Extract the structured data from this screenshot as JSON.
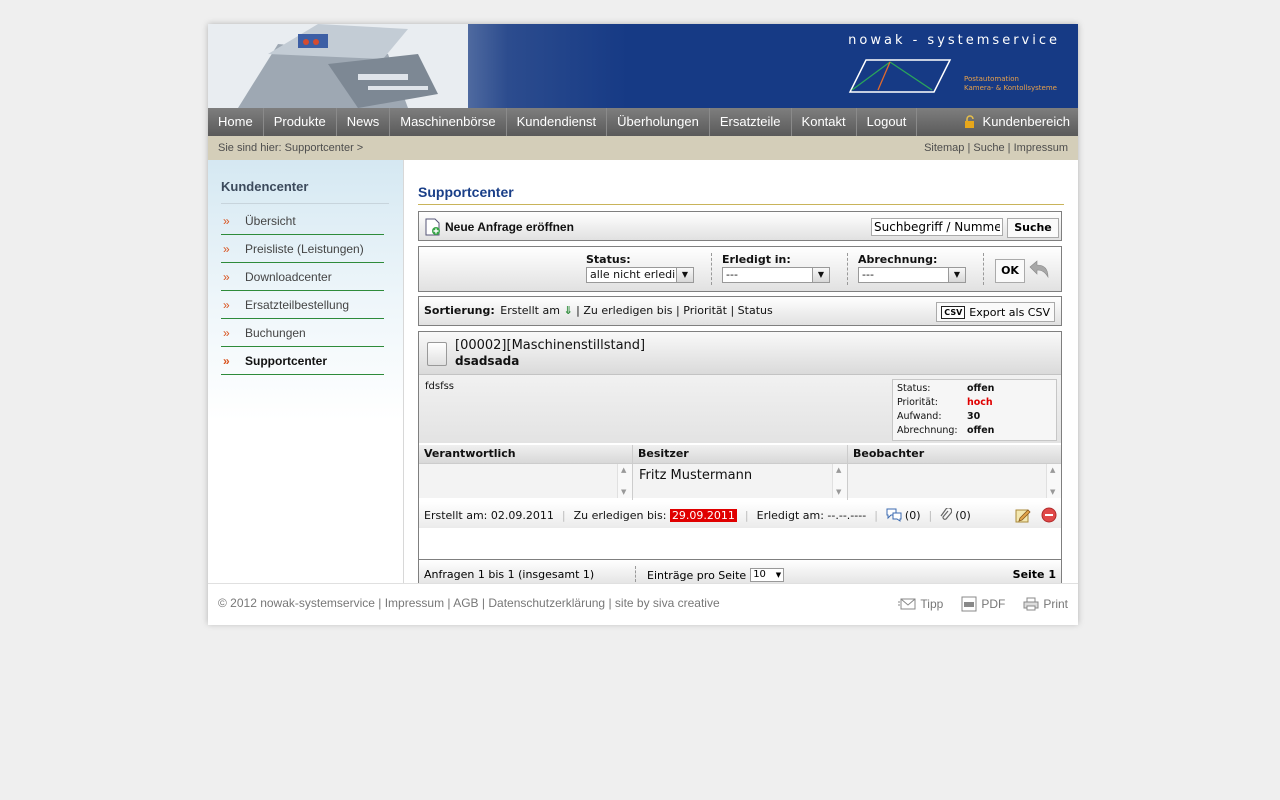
{
  "brand": {
    "name": "nowak - systemservice",
    "tagline_line1": "Postautomation",
    "tagline_line2": "Kamera- & Kontollsysteme"
  },
  "nav": {
    "items": [
      "Home",
      "Produkte",
      "News",
      "Maschinenbörse",
      "Kundendienst",
      "Überholungen",
      "Ersatzteile",
      "Kontakt",
      "Logout"
    ],
    "customer_area": "Kundenbereich"
  },
  "breadcrumb": {
    "text": "Sie sind hier: Supportcenter >",
    "sitemap": "Sitemap",
    "search": "Suche",
    "impressum": "Impressum",
    "sep": "|"
  },
  "sidebar": {
    "title": "Kundencenter",
    "items": [
      "Übersicht",
      "Preisliste (Leistungen)",
      "Downloadcenter",
      "Ersatzteilbestellung",
      "Buchungen",
      "Supportcenter"
    ]
  },
  "main": {
    "title": "Supportcenter",
    "new_request": "Neue Anfrage eröffnen",
    "search_placeholder": "Suchbegriff / Nummer",
    "search_button": "Suche",
    "filters": {
      "status_label": "Status:",
      "status_value": "alle nicht erledi",
      "done_label": "Erledigt in:",
      "done_value": "---",
      "billing_label": "Abrechnung:",
      "billing_value": "---",
      "ok": "OK"
    },
    "sort": {
      "label": "Sortierung:",
      "created": "Erstellt am",
      "due": "Zu erledigen bis",
      "priority": "Priorität",
      "status": "Status",
      "sep": "|"
    },
    "export": {
      "icon_text": "CSV",
      "label": "Export als CSV"
    },
    "ticket": {
      "id": "[00002][Maschinenstillstand]",
      "subject": "dsadsada",
      "description": "fdsfss",
      "info": {
        "status_k": "Status:",
        "status_v": "offen",
        "priority_k": "Priorität:",
        "priority_v": "hoch",
        "effort_k": "Aufwand:",
        "effort_v": "30",
        "billing_k": "Abrechnung:",
        "billing_v": "offen"
      },
      "cols": {
        "responsible": "Verantwortlich",
        "owner": "Besitzer",
        "observer": "Beobachter",
        "owner_name": "Fritz Mustermann"
      },
      "footer": {
        "created_label": "Erstellt am: 02.09.2011",
        "due_label": "Zu erledigen bis:",
        "due_value": "29.09.2011",
        "done_label": "Erledigt am: --.--.----",
        "comments": "(0)",
        "attachments": "(0)"
      },
      "colors": {
        "due_bg": "#e00000",
        "priority": "#e00000"
      }
    },
    "pagination": {
      "range": "Anfragen 1 bis 1 (insgesamt 1)",
      "per_page_label": "Einträge pro Seite",
      "per_page_value": "10",
      "page": "Seite 1"
    }
  },
  "footer": {
    "copyright": "© 2012 nowak-systemservice",
    "impressum": "Impressum",
    "agb": "AGB",
    "privacy": "Datenschutzerklärung",
    "credit": "site by siva creative",
    "sep": "|",
    "tipp": "Tipp",
    "pdf": "PDF",
    "print": "Print"
  }
}
